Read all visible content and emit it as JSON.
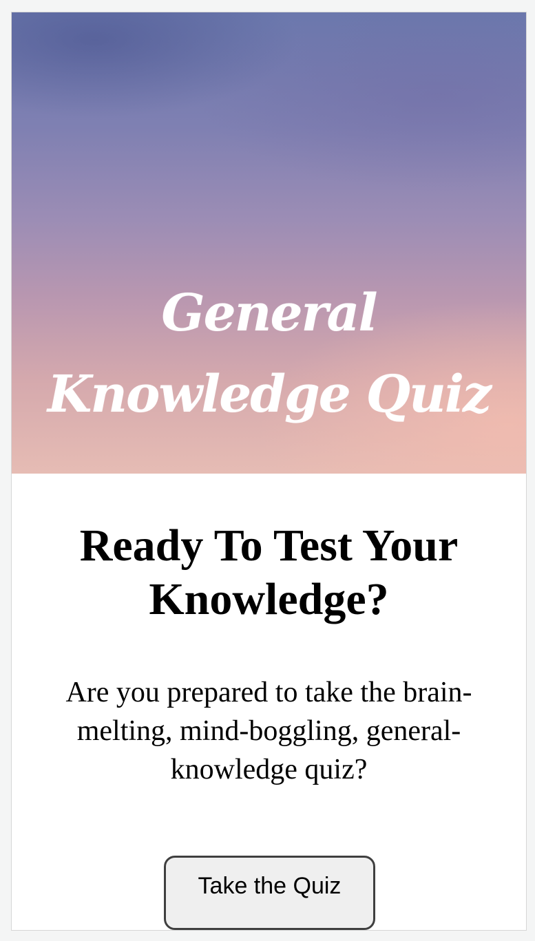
{
  "hero": {
    "title": "General Knowledge Quiz"
  },
  "main": {
    "heading": "Ready To Test Your Knowledge?",
    "description": "Are you prepared to take the brain-melting, mind-boggling, general-knowledge quiz?",
    "button_label": "Take the Quiz"
  }
}
